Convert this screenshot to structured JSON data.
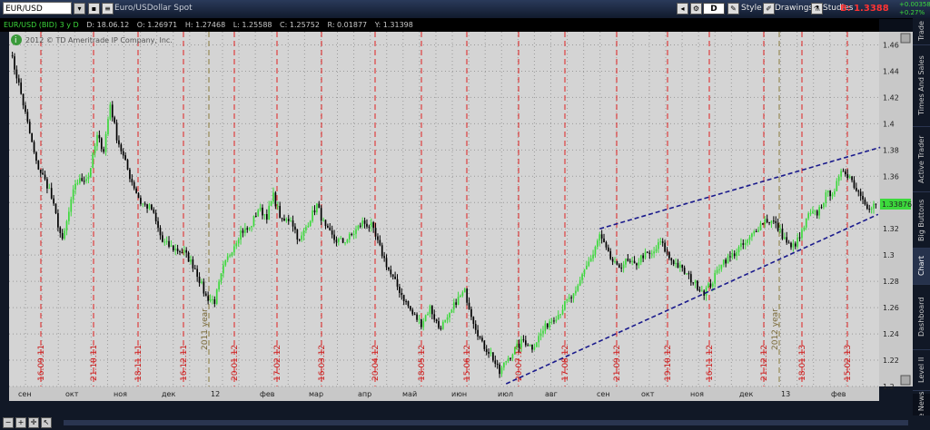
{
  "header": {
    "symbol": "EUR/USD",
    "description": "Euro/USDollar Spot",
    "style_label": "Style",
    "drawings_label": "Drawings",
    "studies_label": "Studies",
    "d_label": "D",
    "bid_label": "B: 1.3388",
    "quote_change": "+0.00358",
    "quote_pct": "+0.27%"
  },
  "infobar": {
    "title": "EUR/USD (BID) 3 y D",
    "date": "D: 18.06.12",
    "open": "O: 1.26971",
    "high": "H: 1.27468",
    "low": "L: 1.25588",
    "close": "C: 1.25752",
    "range": "R: 0.01877",
    "y": "Y: 1.31398"
  },
  "watermark": "2012 © TD Ameritrade IP Company, Inc.",
  "price_tag": "1.33876",
  "tabs": [
    "Trade",
    "Times And Sales",
    "Active Trader",
    "Big Buttons",
    "Chart",
    "Dashboard",
    "Level II",
    "Live News"
  ],
  "active_tab": "Chart",
  "colors": {
    "up": "#3cd93c",
    "down": "#000000",
    "trend": "#1a1a8c",
    "date_marker": "#e02020",
    "grid": "#9a9a9a",
    "plot_bg": "#d4d4d4"
  },
  "chart_data": {
    "type": "candlestick",
    "ylim": [
      1.2,
      1.47
    ],
    "y_ticks": [
      "1.2",
      "1.22",
      "1.24",
      "1.26",
      "1.28",
      "1.3",
      "1.32",
      "1.34",
      "1.36",
      "1.38",
      "1.4",
      "1.42",
      "1.44",
      "1.46"
    ],
    "x_labels": [
      "сен",
      "окт",
      "ноя",
      "дек",
      "12",
      "фев",
      "мар",
      "апр",
      "май",
      "июн",
      "июл",
      "авг",
      "сен",
      "окт",
      "ноя",
      "дек",
      "13",
      "фев"
    ],
    "date_markers": [
      "16.09.11",
      "21.10.11",
      "18.11.11",
      "16.12.11",
      "20.01.12",
      "17.02.12",
      "16.03.12",
      "20.04.12",
      "18.05.12",
      "15.06.12",
      "20.07.12",
      "17.08.12",
      "21.09.12",
      "19.10.12",
      "16.11.12",
      "21.12.12",
      "18.01.13",
      "15.02.13"
    ],
    "year_markers": [
      "2011 year",
      "2012 year"
    ],
    "anchors": [
      [
        0,
        1.455
      ],
      [
        4,
        1.43
      ],
      [
        12,
        1.37
      ],
      [
        18,
        1.35
      ],
      [
        24,
        1.31
      ],
      [
        30,
        1.355
      ],
      [
        36,
        1.36
      ],
      [
        40,
        1.39
      ],
      [
        43,
        1.38
      ],
      [
        46,
        1.415
      ],
      [
        49,
        1.39
      ],
      [
        55,
        1.36
      ],
      [
        60,
        1.34
      ],
      [
        65,
        1.335
      ],
      [
        70,
        1.31
      ],
      [
        75,
        1.305
      ],
      [
        80,
        1.302
      ],
      [
        85,
        1.29
      ],
      [
        90,
        1.268
      ],
      [
        94,
        1.265
      ],
      [
        98,
        1.29
      ],
      [
        102,
        1.305
      ],
      [
        106,
        1.318
      ],
      [
        110,
        1.32
      ],
      [
        114,
        1.335
      ],
      [
        118,
        1.33
      ],
      [
        121,
        1.345
      ],
      [
        125,
        1.325
      ],
      [
        129,
        1.328
      ],
      [
        133,
        1.31
      ],
      [
        137,
        1.325
      ],
      [
        141,
        1.338
      ],
      [
        145,
        1.32
      ],
      [
        149,
        1.312
      ],
      [
        153,
        1.31
      ],
      [
        157,
        1.315
      ],
      [
        162,
        1.325
      ],
      [
        166,
        1.322
      ],
      [
        170,
        1.305
      ],
      [
        175,
        1.285
      ],
      [
        180,
        1.27
      ],
      [
        185,
        1.255
      ],
      [
        189,
        1.248
      ],
      [
        193,
        1.26
      ],
      [
        197,
        1.245
      ],
      [
        201,
        1.25
      ],
      [
        205,
        1.265
      ],
      [
        209,
        1.272
      ],
      [
        213,
        1.25
      ],
      [
        217,
        1.232
      ],
      [
        221,
        1.225
      ],
      [
        225,
        1.21
      ],
      [
        228,
        1.22
      ],
      [
        232,
        1.228
      ],
      [
        236,
        1.235
      ],
      [
        240,
        1.23
      ],
      [
        244,
        1.24
      ],
      [
        248,
        1.25
      ],
      [
        252,
        1.255
      ],
      [
        256,
        1.265
      ],
      [
        260,
        1.27
      ],
      [
        264,
        1.29
      ],
      [
        268,
        1.3
      ],
      [
        271,
        1.315
      ],
      [
        275,
        1.3
      ],
      [
        279,
        1.29
      ],
      [
        283,
        1.295
      ],
      [
        287,
        1.292
      ],
      [
        291,
        1.3
      ],
      [
        295,
        1.3
      ],
      [
        299,
        1.31
      ],
      [
        303,
        1.298
      ],
      [
        307,
        1.292
      ],
      [
        311,
        1.285
      ],
      [
        315,
        1.278
      ],
      [
        319,
        1.272
      ],
      [
        323,
        1.28
      ],
      [
        327,
        1.295
      ],
      [
        331,
        1.298
      ],
      [
        335,
        1.305
      ],
      [
        339,
        1.31
      ],
      [
        343,
        1.32
      ],
      [
        347,
        1.327
      ],
      [
        351,
        1.325
      ],
      [
        355,
        1.315
      ],
      [
        359,
        1.305
      ],
      [
        363,
        1.313
      ],
      [
        367,
        1.33
      ],
      [
        371,
        1.332
      ],
      [
        375,
        1.345
      ],
      [
        379,
        1.35
      ],
      [
        383,
        1.365
      ],
      [
        386,
        1.36
      ],
      [
        389,
        1.35
      ],
      [
        392,
        1.345
      ],
      [
        395,
        1.334
      ],
      [
        398,
        1.3388
      ]
    ],
    "trendlines": [
      {
        "from": [
          228,
          1.202
        ],
        "to": [
          399,
          1.331
        ],
        "style": "dashed"
      },
      {
        "from": [
          271,
          1.32
        ],
        "to": [
          400,
          1.382
        ],
        "style": "dashed"
      }
    ]
  }
}
